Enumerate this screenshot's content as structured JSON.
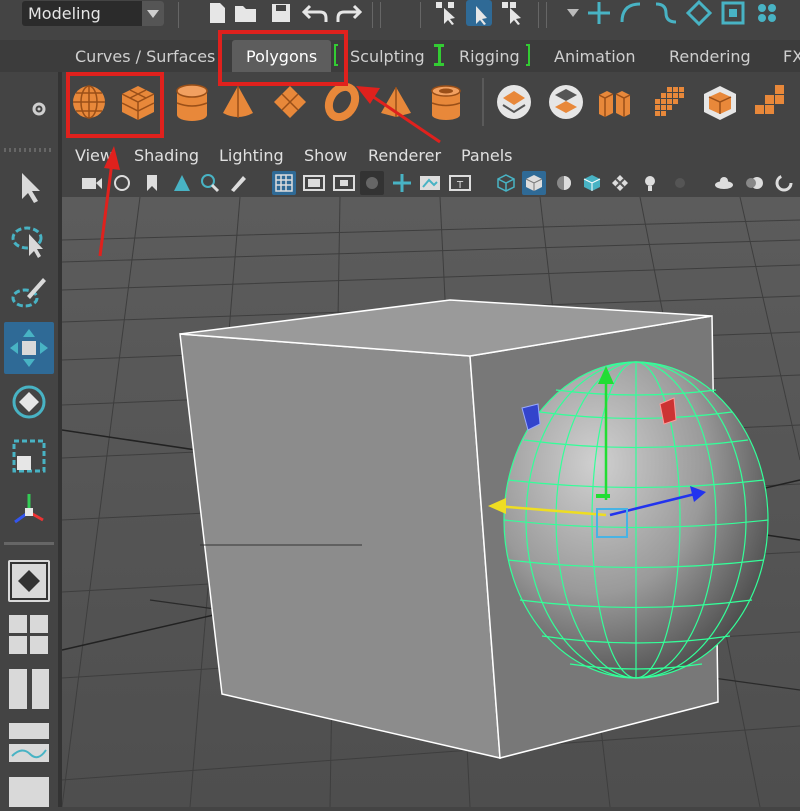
{
  "toolbar": {
    "mode": "Modeling",
    "icons": [
      "new-scene-icon",
      "open-scene-icon",
      "save-scene-icon",
      "undo-icon",
      "redo-icon",
      "select-hierarchy-icon",
      "select-object-icon",
      "select-component-icon",
      "snap-grid-icon",
      "snap-curve-icon",
      "snap-point-icon",
      "snap-view-icon",
      "snap-surface-icon",
      "snap-live-icon"
    ]
  },
  "shelf_tabs": {
    "curves": "Curves / Surfaces",
    "polygons": "Polygons",
    "sculpting": "Sculpting",
    "rigging": "Rigging",
    "animation": "Animation",
    "rendering": "Rendering",
    "fx": "FX"
  },
  "shelf_icons": [
    "poly-sphere-icon",
    "poly-cube-icon",
    "poly-cylinder-icon",
    "poly-cone-icon",
    "poly-plane-icon",
    "poly-torus-icon",
    "poly-pyramid-icon",
    "poly-pipe-icon",
    "combine-icon",
    "separate-icon",
    "extract-icon",
    "smooth-icon",
    "bevel-icon",
    "bridge-icon"
  ],
  "panel_menus": {
    "view": "View",
    "shading": "Shading",
    "lighting": "Lighting",
    "show": "Show",
    "renderer": "Renderer",
    "panels": "Panels"
  },
  "tools": [
    "select-tool-icon",
    "lasso-tool-icon",
    "paint-select-icon",
    "move-tool-icon",
    "rotate-tool-icon",
    "scale-tool-icon",
    "last-tool-icon"
  ],
  "colors": {
    "accent_orange": "#e8883a",
    "highlight_red": "#e0211d",
    "wireframe_green": "#33ff99",
    "tool_active_blue": "#2f6a96"
  }
}
